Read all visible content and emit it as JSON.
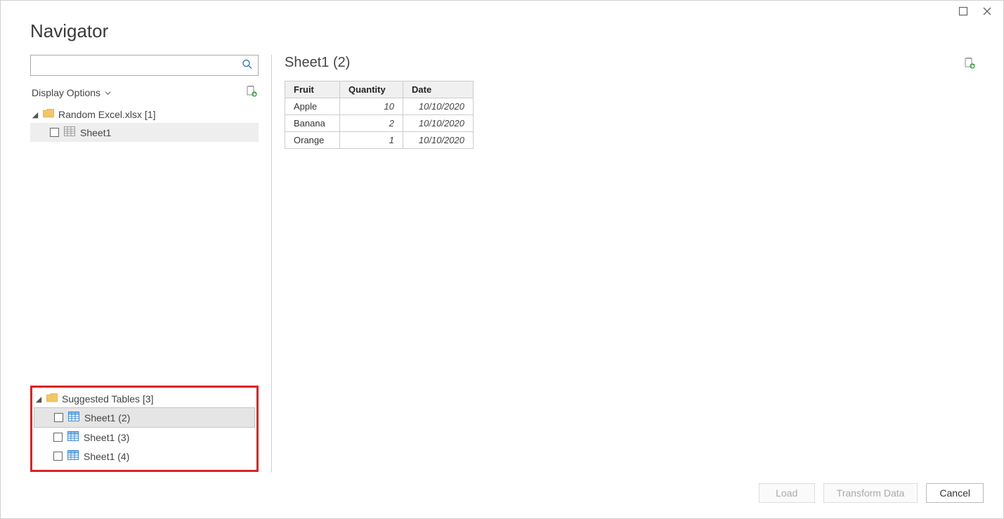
{
  "window": {
    "title": "Navigator"
  },
  "search": {
    "placeholder": ""
  },
  "displayOptions": {
    "label": "Display Options"
  },
  "tree": {
    "group1": {
      "label": "Random Excel.xlsx [1]",
      "items": [
        {
          "label": "Sheet1"
        }
      ]
    },
    "group2": {
      "label": "Suggested Tables [3]",
      "items": [
        {
          "label": "Sheet1 (2)"
        },
        {
          "label": "Sheet1 (3)"
        },
        {
          "label": "Sheet1 (4)"
        }
      ]
    }
  },
  "preview": {
    "title": "Sheet1 (2)",
    "columns": [
      "Fruit",
      "Quantity",
      "Date"
    ],
    "rows": [
      {
        "c0": "Apple",
        "c1": "10",
        "c2": "10/10/2020"
      },
      {
        "c0": "Banana",
        "c1": "2",
        "c2": "10/10/2020"
      },
      {
        "c0": "Orange",
        "c1": "1",
        "c2": "10/10/2020"
      }
    ]
  },
  "footer": {
    "load": "Load",
    "transform": "Transform Data",
    "cancel": "Cancel"
  }
}
